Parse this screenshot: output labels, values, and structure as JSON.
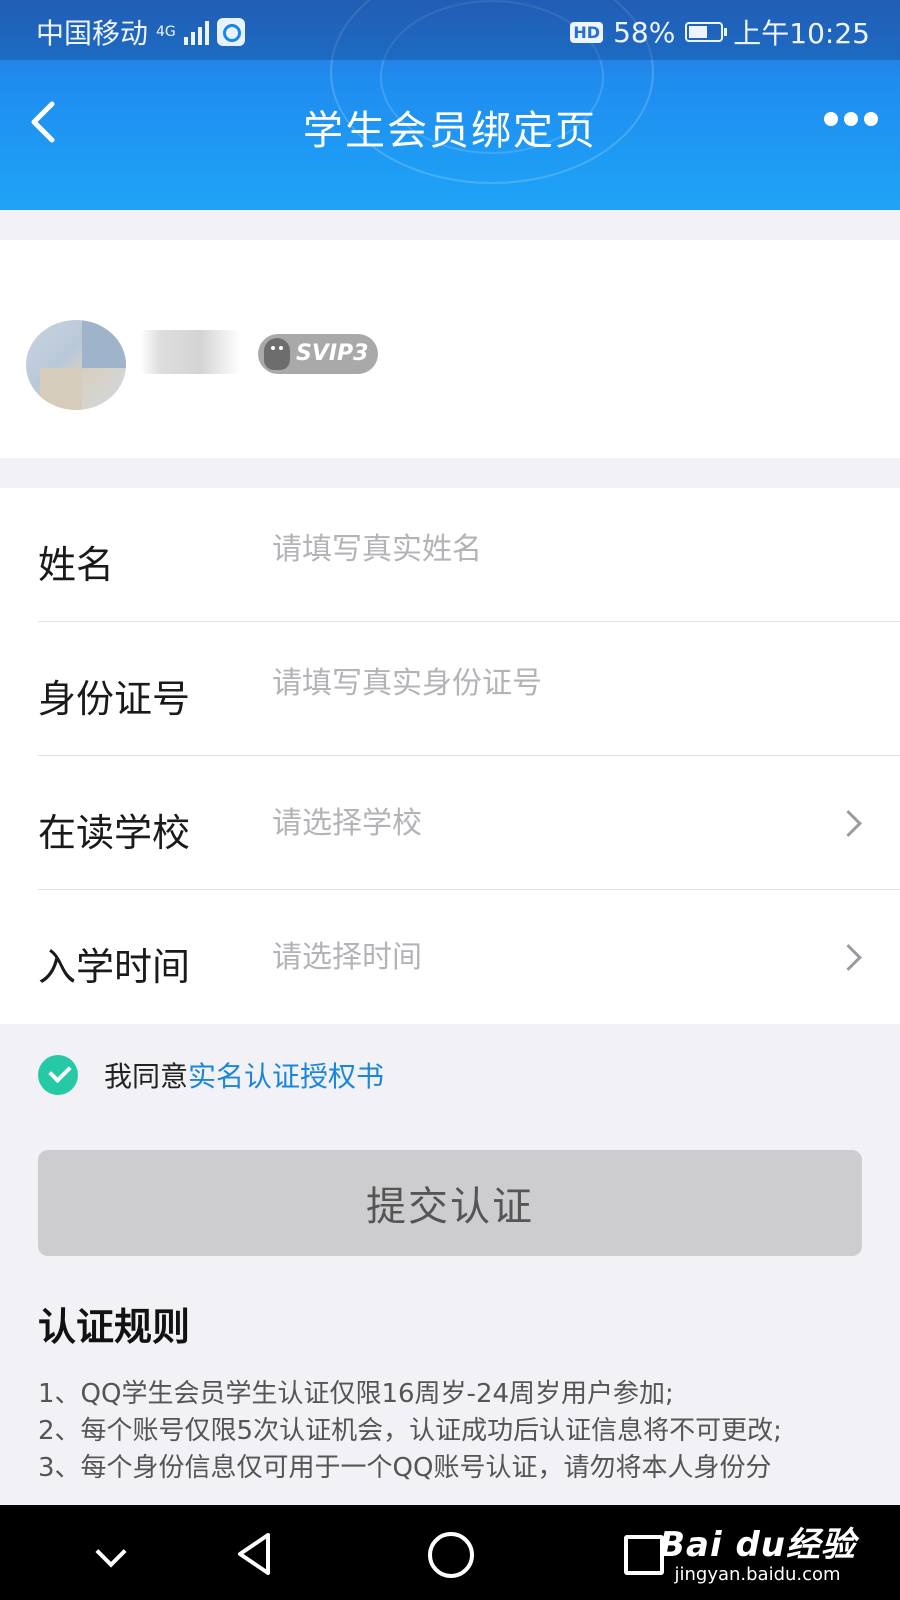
{
  "status_bar": {
    "carrier": "中国移动",
    "network": "4G",
    "hd": "HD",
    "battery": "58%",
    "time": "上午10:25"
  },
  "nav": {
    "title": "学生会员绑定页"
  },
  "profile": {
    "badge": "SVIP3"
  },
  "form": {
    "name": {
      "label": "姓名",
      "placeholder": "请填写真实姓名",
      "value": ""
    },
    "id_number": {
      "label": "身份证号",
      "placeholder": "请填写真实身份证号",
      "value": ""
    },
    "school": {
      "label": "在读学校",
      "placeholder": "请选择学校"
    },
    "enroll_time": {
      "label": "入学时间",
      "placeholder": "请选择时间"
    }
  },
  "agreement": {
    "prefix": "我同意",
    "link": "实名认证授权书",
    "checked": true
  },
  "submit": {
    "label": "提交认证"
  },
  "rules": {
    "title": "认证规则",
    "items": [
      "1、QQ学生会员学生认证仅限16周岁-24周岁用户参加;",
      "2、每个账号仅限5次认证机会，认证成功后认证信息将不可更改;",
      "3、每个身份信息仅可用于一个QQ账号认证，请勿将本人身份分"
    ]
  },
  "watermark": {
    "logo": "Bai du经验",
    "url": "jingyan.baidu.com"
  },
  "colors": {
    "header_blue": "#1f8df0",
    "link_blue": "#1a86dc",
    "check_green": "#26c9a6",
    "button_disabled": "#cdcdd0"
  }
}
